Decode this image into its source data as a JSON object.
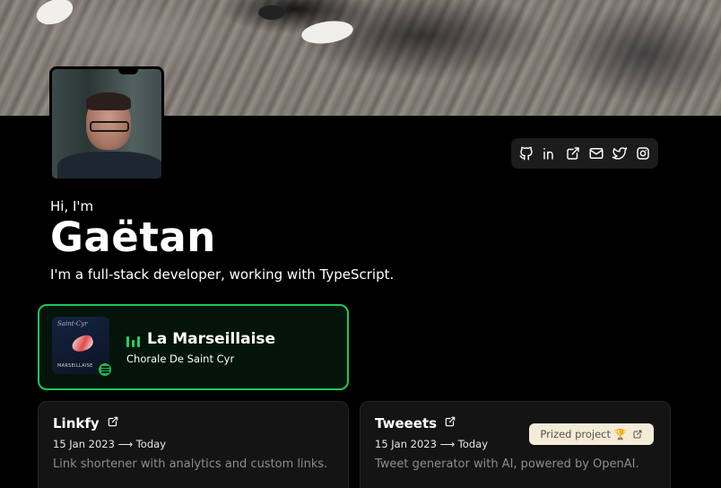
{
  "profile": {
    "greeting": "Hi, I'm",
    "name": "Gaëtan",
    "tagline": "I'm a full-stack developer, working with TypeScript."
  },
  "socials": [
    {
      "icon": "github-icon"
    },
    {
      "icon": "linkedin-icon"
    },
    {
      "icon": "external-link-icon"
    },
    {
      "icon": "mail-icon"
    },
    {
      "icon": "twitter-icon"
    },
    {
      "icon": "instagram-icon"
    }
  ],
  "now_playing": {
    "song": "La Marseillaise",
    "artist": "Chorale De Saint Cyr",
    "cover_script": "Saint-Cyr",
    "cover_subtitle": "MARSEILLAISE",
    "icon": "spotify-icon",
    "accent": "#1fc65a"
  },
  "projects": [
    {
      "title": "Linkfy",
      "dates": "15 Jan 2023 ⟶ Today",
      "description": "Link shortener with analytics and custom links."
    },
    {
      "title": "Tweeets",
      "dates": "15 Jan 2023 ⟶ Today",
      "description": "Tweet generator with AI, powered by OpenAI.",
      "badge": "Prized project 🏆"
    }
  ],
  "colors": {
    "background": "#000000",
    "card": "#141414",
    "spotify_bg": "#03140a",
    "badge_bg": "#f4ecd8"
  }
}
